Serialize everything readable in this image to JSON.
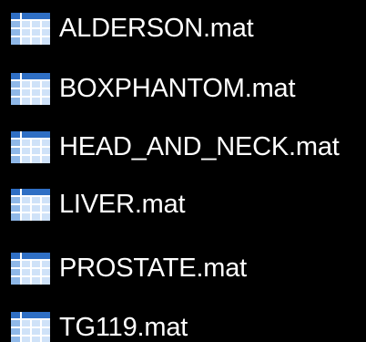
{
  "files": [
    {
      "name": "ALDERSON.mat",
      "icon": "table-icon"
    },
    {
      "name": "BOXPHANTOM.mat",
      "icon": "table-icon"
    },
    {
      "name": "HEAD_AND_NECK.mat",
      "icon": "table-icon"
    },
    {
      "name": "LIVER.mat",
      "icon": "table-icon"
    },
    {
      "name": "PROSTATE.mat",
      "icon": "table-icon"
    },
    {
      "name": "TG119.mat",
      "icon": "table-icon"
    }
  ],
  "colors": {
    "background": "#000000",
    "text": "#ffffff",
    "icon_header": "#2f6fc4",
    "icon_cell": "#cfe2f8",
    "icon_grid": "#ffffff"
  }
}
